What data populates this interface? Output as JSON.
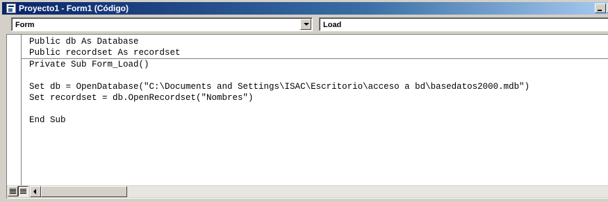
{
  "window": {
    "title": "Proyecto1 - Form1 (Código)"
  },
  "object_combo": {
    "value": "Form"
  },
  "procedure_combo": {
    "value": "Load"
  },
  "code": {
    "declarations": [
      "Public db As Database",
      "Public recordset As recordset"
    ],
    "procedure": [
      "Private Sub Form_Load()",
      "",
      "Set db = OpenDatabase(\"C:\\Documents and Settings\\ISAC\\Escritorio\\acceso a bd\\basedatos2000.mdb\")",
      "Set recordset = db.OpenRecordset(\"Nombres\")",
      "",
      "End Sub"
    ]
  },
  "icons": {
    "window": "vb-form-icon",
    "dropdown": "chevron-down-icon",
    "procedure_view": "procedure-view-icon",
    "full_module_view": "full-module-view-icon",
    "scroll_left": "arrow-left-icon"
  }
}
